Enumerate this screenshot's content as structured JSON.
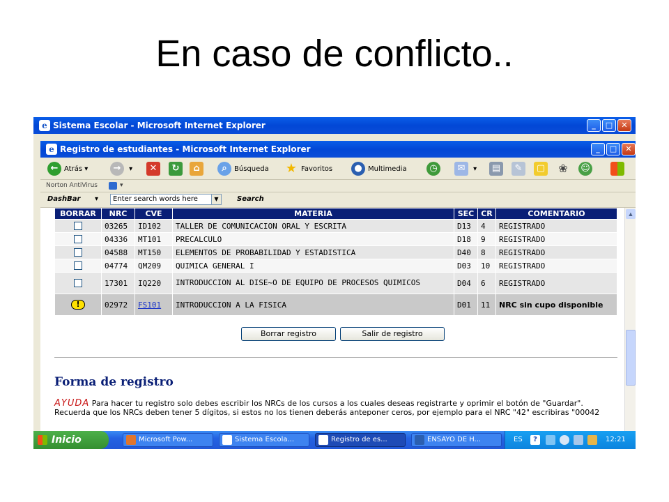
{
  "slide": {
    "title": "En caso de conflicto.."
  },
  "outer_window": {
    "title": "Sistema Escolar - Microsoft Internet Explorer"
  },
  "inner_window": {
    "title": "Registro de estudiantes - Microsoft Internet Explorer"
  },
  "toolbar": {
    "back_label": "Atrás",
    "search_label": "Búsqueda",
    "favorites_label": "Favoritos",
    "multimedia_label": "Multimedia"
  },
  "norton": {
    "label": "Norton AntiVirus"
  },
  "dashbar": {
    "label": "DashBar",
    "search_value": "Enter search words here",
    "search_button": "Search"
  },
  "table": {
    "headers": [
      "BORRAR",
      "NRC",
      "CVE",
      "MATERIA",
      "SEC",
      "CR",
      "COMENTARIO"
    ],
    "rows": [
      {
        "nrc": "03265",
        "cve": "ID102",
        "materia": "TALLER DE COMUNICACION ORAL Y ESCRITA",
        "sec": "D13",
        "cr": "4",
        "comentario": "REGISTRADO"
      },
      {
        "nrc": "04336",
        "cve": "MT101",
        "materia": "PRECALCULO",
        "sec": "D18",
        "cr": "9",
        "comentario": "REGISTRADO"
      },
      {
        "nrc": "04588",
        "cve": "MT150",
        "materia": "ELEMENTOS DE PROBABILIDAD Y ESTADISTICA",
        "sec": "D40",
        "cr": "8",
        "comentario": "REGISTRADO"
      },
      {
        "nrc": "04774",
        "cve": "QM209",
        "materia": "QUIMICA GENERAL I",
        "sec": "D03",
        "cr": "10",
        "comentario": "REGISTRADO"
      },
      {
        "nrc": "17301",
        "cve": "IQ220",
        "materia": "INTRODUCCION AL DISE~O DE EQUIPO DE PROCESOS QUIMICOS",
        "sec": "D04",
        "cr": "6",
        "comentario": "REGISTRADO"
      },
      {
        "nrc": "02972",
        "cve": "FS101",
        "materia": "INTRODUCCION A LA FISICA",
        "sec": "D01",
        "cr": "11",
        "comentario": "NRC sin cupo disponible",
        "warning": "!"
      }
    ]
  },
  "buttons": {
    "delete": "Borrar registro",
    "exit": "Salir de registro"
  },
  "form": {
    "title": "Forma de registro",
    "help_keyword": "AYUDA",
    "help_text": "Para hacer tu registro solo debes escribir los NRCs de los cursos a los cuales deseas registrarte y oprimir el botón de \"Guardar\". Recuerda que los NRCs deben tener 5 dígitos, si estos no los tienen deberás anteponer ceros, por ejemplo para el NRC \"42\" escribiras \"00042"
  },
  "taskbar": {
    "start": "Inicio",
    "tasks": [
      "Microsoft Pow...",
      "Sistema Escola...",
      "Registro de es...",
      "ENSAYO DE H..."
    ],
    "lang": "ES",
    "clock": "12:21"
  },
  "colors": {
    "table_header": "#0a1f76",
    "title_bar": "#0247d6",
    "taskbar": "#2462e2",
    "start_button": "#348f30",
    "help_keyword": "#c81414"
  }
}
